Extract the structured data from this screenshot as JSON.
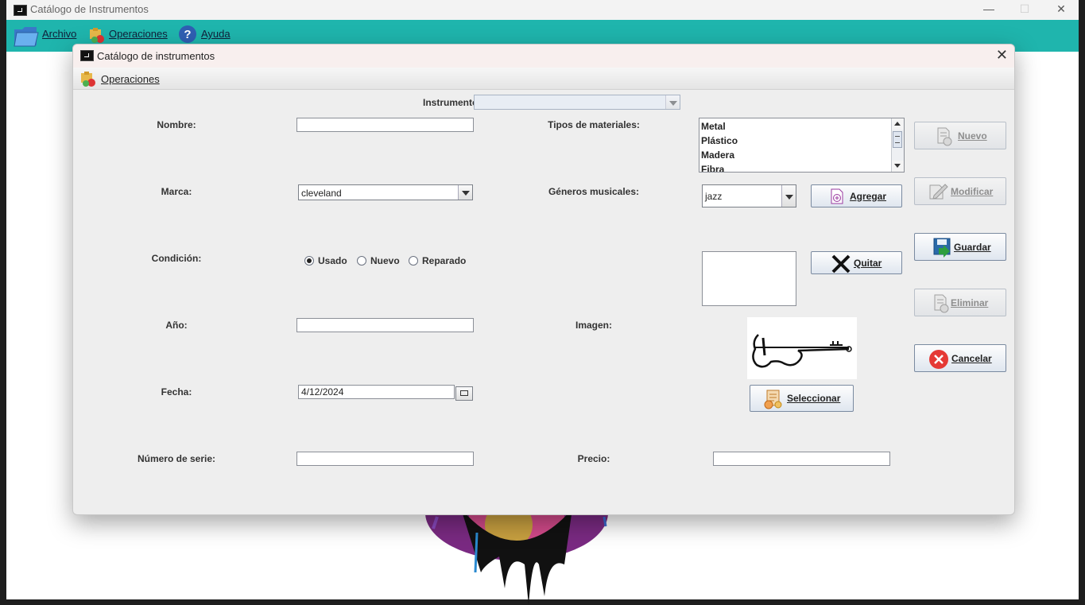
{
  "main_window": {
    "title": "Catálogo de Instrumentos",
    "menu": {
      "archivo": "Archivo",
      "operaciones": "Operaciones",
      "ayuda": "Ayuda"
    }
  },
  "dialog": {
    "title": "Catálogo de instrumentos",
    "menu": {
      "operaciones": "Operaciones"
    },
    "instrumentos_label": "Instrumentos:",
    "instrumentos_value": "",
    "form": {
      "nombre_label": "Nombre:",
      "nombre_value": "",
      "marca_label": "Marca:",
      "marca_value": "cleveland",
      "condicion_label": "Condición:",
      "condicion_options": [
        "Usado",
        "Nuevo",
        "Reparado"
      ],
      "condicion_selected": "Usado",
      "anio_label": "Año:",
      "anio_value": "",
      "fecha_label": "Fecha:",
      "fecha_value": "4/12/2024",
      "serie_label": "Número de serie:",
      "serie_value": "",
      "materiales_label": "Tipos de materiales:",
      "materiales": [
        "Metal",
        "Plástico",
        "Madera",
        "Fibra"
      ],
      "generos_label": "Géneros musicales:",
      "generos_value": "jazz",
      "imagen_label": "Imagen:",
      "precio_label": "Precio:",
      "precio_value": ""
    },
    "buttons": {
      "agregar": "Agregar",
      "quitar": "Quitar",
      "seleccionar": "Seleccionar",
      "nuevo": "Nuevo",
      "modificar": "Modificar",
      "guardar": "Guardar",
      "eliminar": "Eliminar",
      "cancelar": "Cancelar"
    }
  },
  "colors": {
    "menubar": "#1fb5ad",
    "dialog_bg": "#eeeeee",
    "cancel_icon": "#e53935",
    "save_icon": "#2e7d32"
  }
}
